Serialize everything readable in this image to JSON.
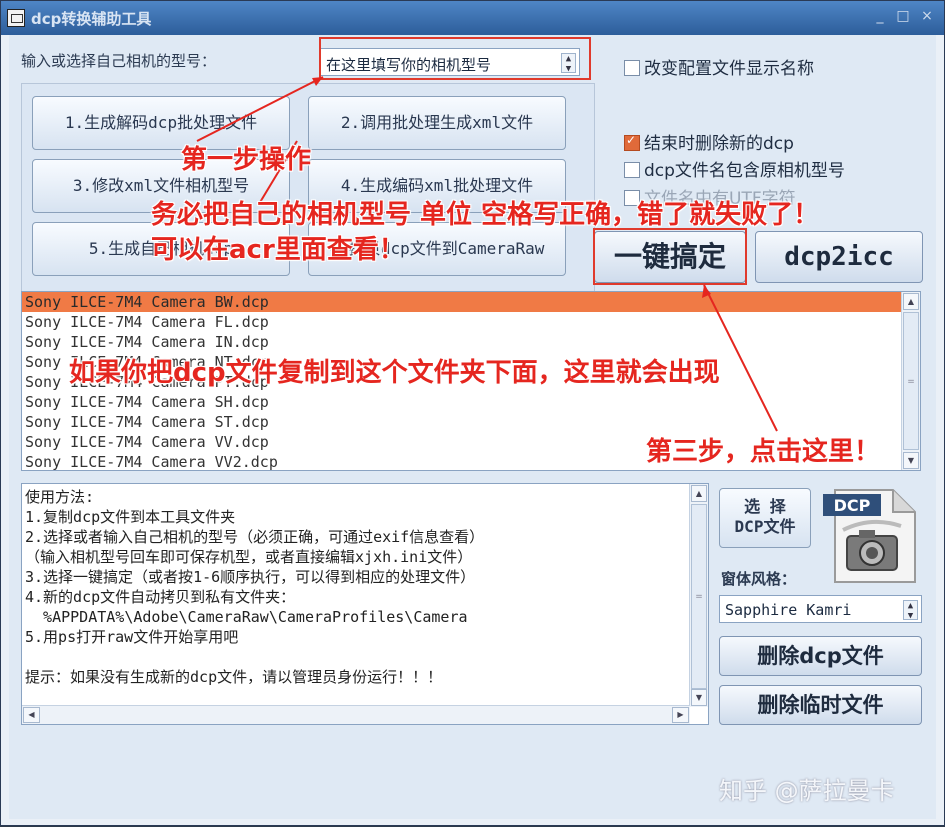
{
  "window": {
    "title": "dcp转换辅助工具",
    "controls": [
      "_",
      "□",
      "×"
    ]
  },
  "camera": {
    "label": "输入或选择自己相机的型号：",
    "model_placeholder": "在这里填写你的相机型号"
  },
  "steps": [
    {
      "label": "1.生成解码dcp批处理文件"
    },
    {
      "label": "2.调用批处理生成xml文件"
    },
    {
      "label": "3.修改xml文件相机型号"
    },
    {
      "label": "4.生成编码xml批处理文件"
    },
    {
      "label": "5.生成自己相机dcp"
    },
    {
      "label": "6.拷贝dcp文件到CameraRaw"
    }
  ],
  "options": {
    "rename_display": {
      "label": "改变配置文件显示名称",
      "checked": false
    },
    "delete_new": {
      "label": "结束时删除新的dcp",
      "checked": true
    },
    "include_model": {
      "label": "dcp文件名包含原相机型号",
      "checked": false
    },
    "utf_chars": {
      "label": "文件名中有UTF字符",
      "checked": false
    }
  },
  "actions": {
    "one_click": "一键搞定",
    "dcp2icc": "dcp2icc"
  },
  "dcp_list": {
    "items": [
      "Sony ILCE-7M4 Camera BW.dcp",
      "Sony ILCE-7M4 Camera FL.dcp",
      "Sony ILCE-7M4 Camera IN.dcp",
      "Sony ILCE-7M4 Camera NT.dcp",
      "Sony ILCE-7M4 Camera PT.dcp",
      "Sony ILCE-7M4 Camera SH.dcp",
      "Sony ILCE-7M4 Camera ST.dcp",
      "Sony ILCE-7M4 Camera VV.dcp",
      "Sony ILCE-7M4 Camera VV2.dcp"
    ],
    "selected_index": 0
  },
  "usage": {
    "lines": [
      "使用方法:",
      "1.复制dcp文件到本工具文件夹",
      "2.选择或者输入自己相机的型号（必须正确，可通过exif信息查看）",
      "（输入相机型号回车即可保存机型，或者直接编辑xjxh.ini文件）",
      "3.选择一键搞定（或者按1-6顺序执行，可以得到相应的处理文件）",
      "4.新的dcp文件自动拷贝到私有文件夹：",
      "  %APPDATA%\\Adobe\\CameraRaw\\CameraProfiles\\Camera",
      "5.用ps打开raw文件开始享用吧",
      "",
      "提示：如果没有生成新的dcp文件，请以管理员身份运行！！！"
    ]
  },
  "side": {
    "choose_dcp_line1": "选 择",
    "choose_dcp_line2": "DCP文件",
    "icon_label": "DCP",
    "skin_label": "窗体风格：",
    "skin_value": "Sapphire Kamri",
    "delete_dcp": "删除dcp文件",
    "delete_temp": "删除临时文件"
  },
  "annotations": {
    "step1": "第一步操作",
    "step2_line1": "务必把自己的相机型号 单位 空格写正确，错了就失败了！",
    "step2_line2": "可以在acr里面查看！",
    "list_note": "如果你把dcp文件复制到这个文件夹下面，这里就会出现",
    "step3": "第三步，点击这里！",
    "color": "#e5261f"
  },
  "watermark": "知乎 @萨拉曼卡"
}
